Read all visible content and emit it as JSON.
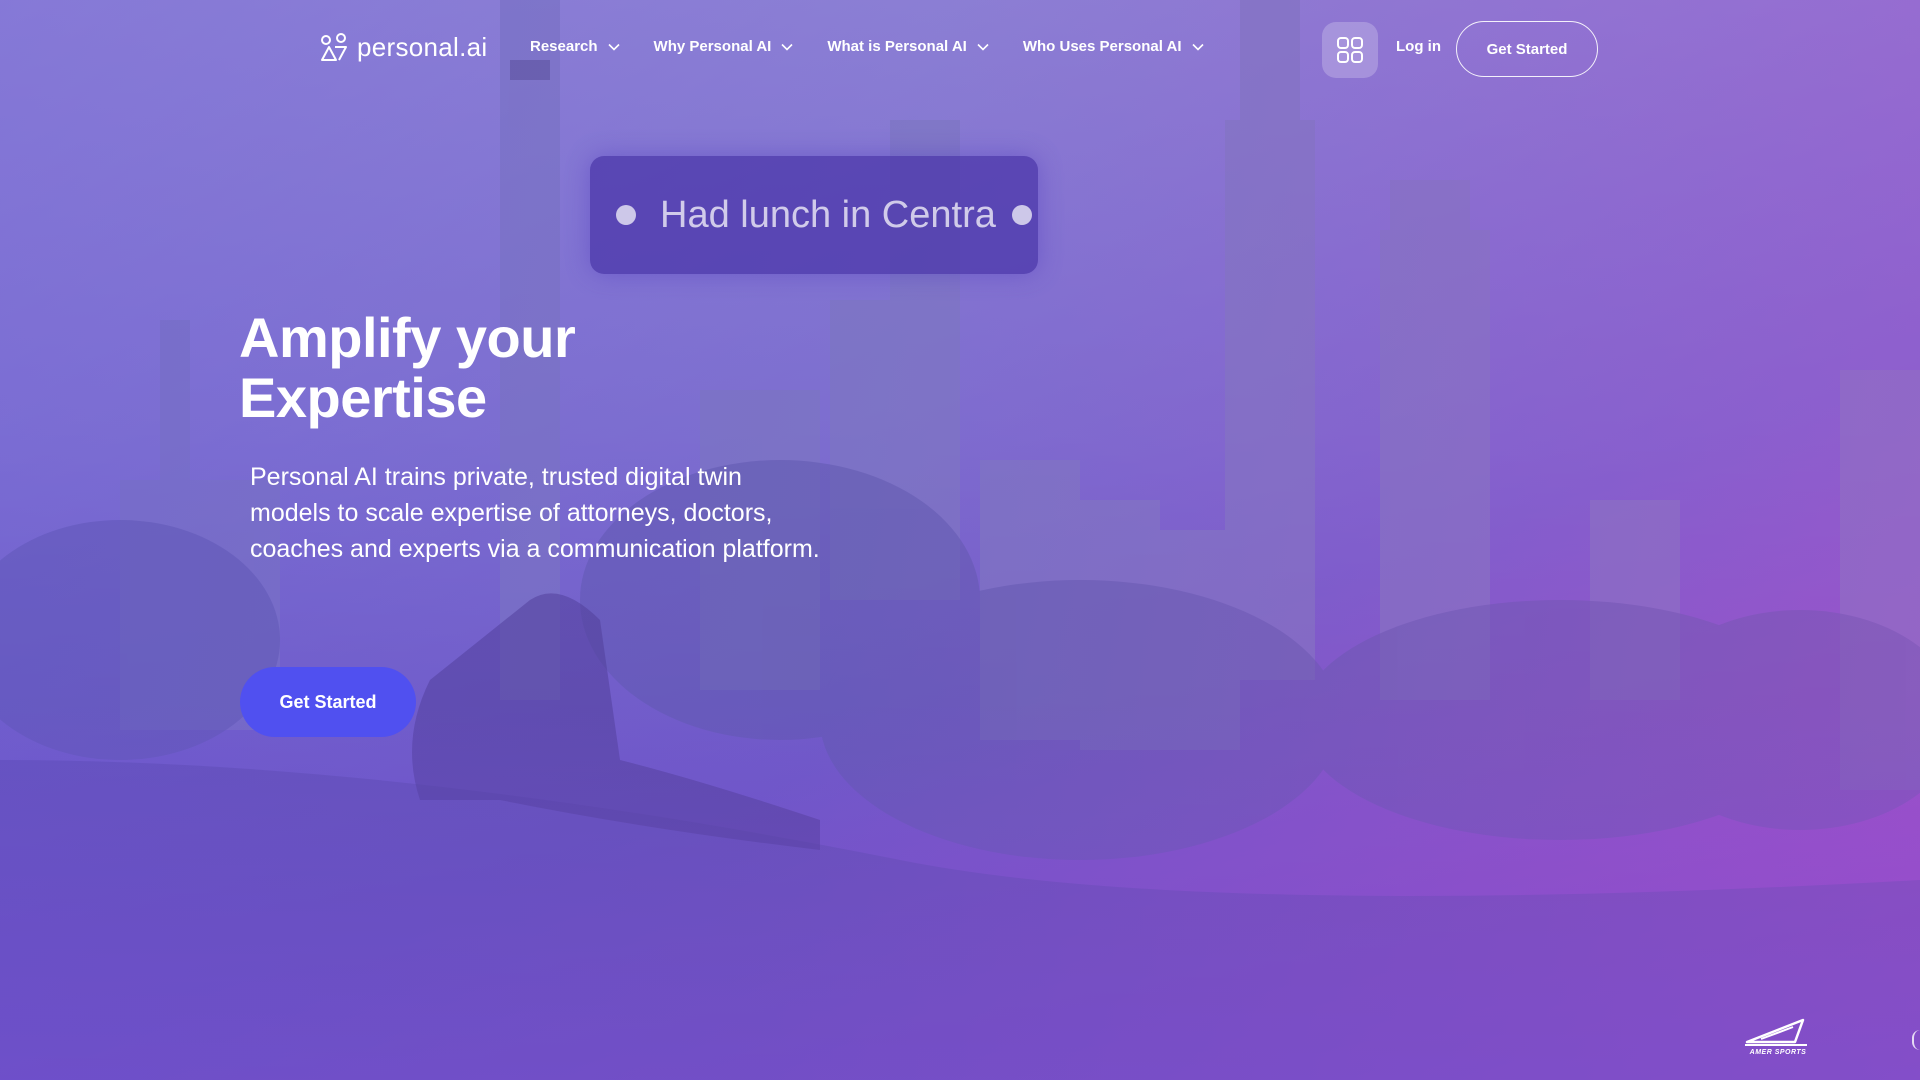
{
  "brand": {
    "logo_text": "personal.ai"
  },
  "nav": {
    "items": [
      {
        "label": "Research",
        "icon": "chevron-down-icon"
      },
      {
        "label": "Why Personal AI",
        "icon": "chevron-down-icon"
      },
      {
        "label": "What is Personal AI",
        "icon": "chevron-down-icon"
      },
      {
        "label": "Who Uses Personal AI",
        "icon": "chevron-down-icon"
      }
    ],
    "apps_icon": "grid-icon",
    "login_label": "Log in",
    "cta_label": "Get Started"
  },
  "hero": {
    "caption_bubble": "Had lunch in Centra",
    "headline_line1": "Amplify your",
    "headline_line2": "Expertise",
    "subtext": "Personal AI trains private, trusted digital twin models to scale expertise of attorneys, doctors, coaches and experts via a communication platform.",
    "cta_label": "Get Started"
  },
  "partners": {
    "logo_text": "AMER SPORTS"
  },
  "colors": {
    "primary_button": "#5050f0",
    "overlay_start": "#7a66d6",
    "overlay_end": "#b04fd0"
  }
}
